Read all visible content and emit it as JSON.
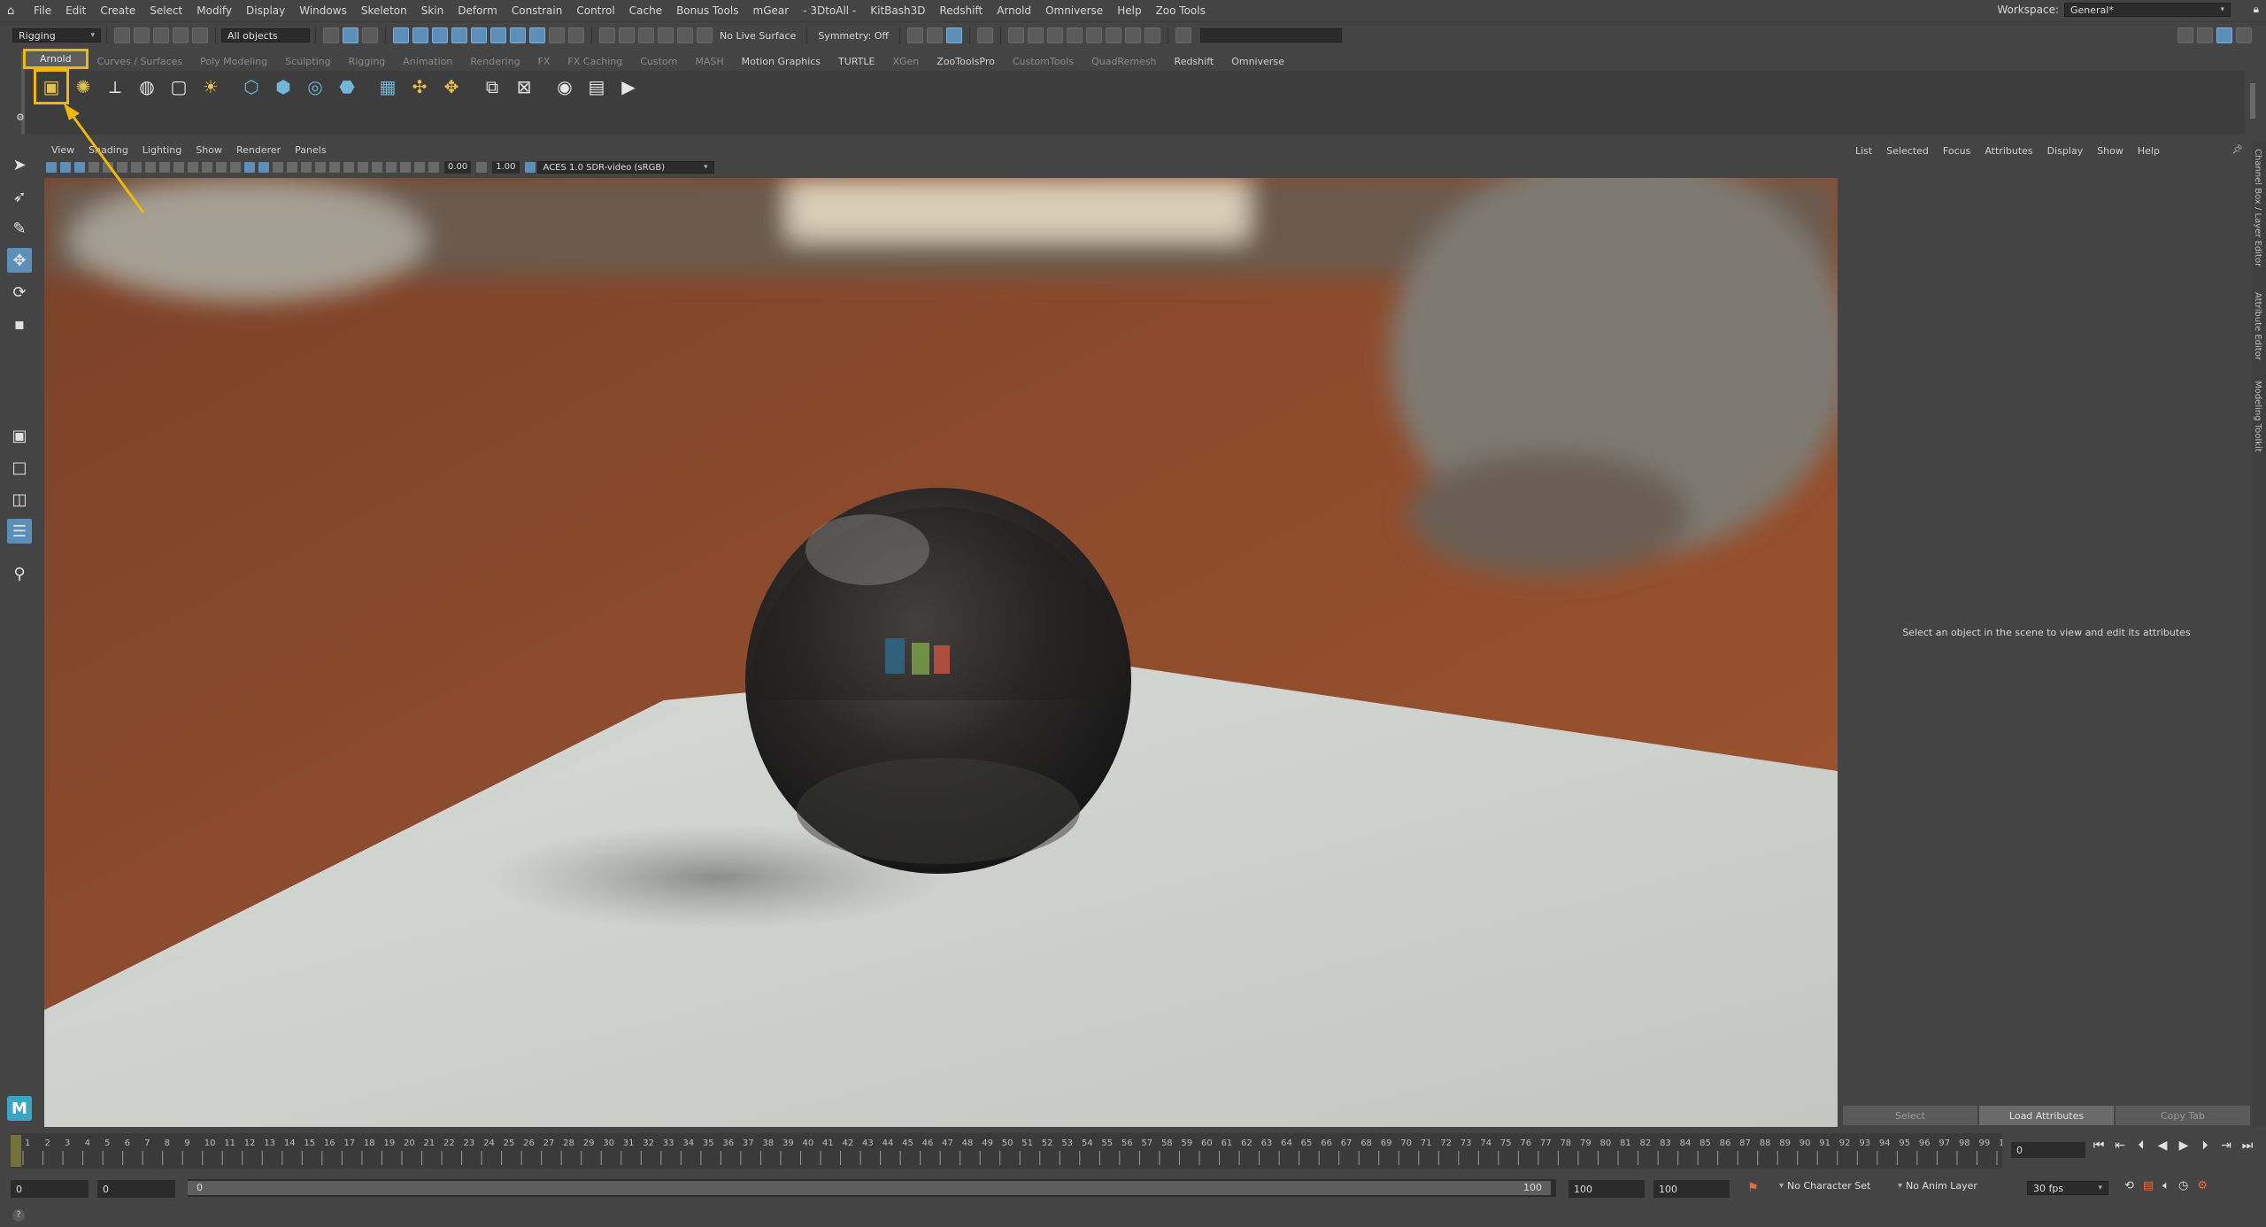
{
  "menubar": {
    "items": [
      "File",
      "Edit",
      "Create",
      "Select",
      "Modify",
      "Display",
      "Windows",
      "Skeleton",
      "Skin",
      "Deform",
      "Constrain",
      "Control",
      "Cache",
      "Bonus Tools",
      "mGear",
      "- 3DtoAll -",
      "KitBash3D",
      "Redshift",
      "Arnold",
      "Omniverse",
      "Help",
      "Zoo Tools"
    ],
    "workspace_label": "Workspace:",
    "workspace_value": "General*"
  },
  "statusline": {
    "mode": "Rigging",
    "selection_mask": "All objects",
    "live_surface": "No Live Surface",
    "symmetry": "Symmetry: Off"
  },
  "shelf": {
    "tabs": [
      "Arnold",
      "Curves / Surfaces",
      "Poly Modeling",
      "Sculpting",
      "Rigging",
      "Animation",
      "Rendering",
      "FX",
      "FX Caching",
      "Custom",
      "MASH",
      "Motion Graphics",
      "TURTLE",
      "XGen",
      "ZooToolsPro",
      "CustomTools",
      "QuadRemesh",
      "Redshift",
      "Omniverse"
    ],
    "active_tab": "Arnold"
  },
  "panel": {
    "menus": [
      "View",
      "Shading",
      "Lighting",
      "Show",
      "Renderer",
      "Panels"
    ],
    "exposure": "0.00",
    "gamma": "1.00",
    "color_space": "ACES 1.0 SDR-video (sRGB)"
  },
  "attribute_editor": {
    "menus": [
      "List",
      "Selected",
      "Focus",
      "Attributes",
      "Display",
      "Show",
      "Help"
    ],
    "message": "Select an object in the scene to view and edit its attributes",
    "buttons": [
      "Select",
      "Load Attributes",
      "Copy Tab"
    ]
  },
  "side_tabs": [
    "Channel Box / Layer Editor",
    "Attribute Editor",
    "Modeling Toolkit"
  ],
  "timeline": {
    "current_frame": "0",
    "start_frame": "1",
    "end_frame": "100",
    "range_start": "0",
    "range_inner_start": "0",
    "slider_start": "0",
    "slider_end": "100",
    "anim_end": "100",
    "total_end": "100",
    "character_set": "No Character Set",
    "anim_layer": "No Anim Layer",
    "fps": "30 fps"
  },
  "colors": {
    "highlight": "#f0b800",
    "accent_blue": "#5b8fb9",
    "ui_bg": "#444444"
  }
}
